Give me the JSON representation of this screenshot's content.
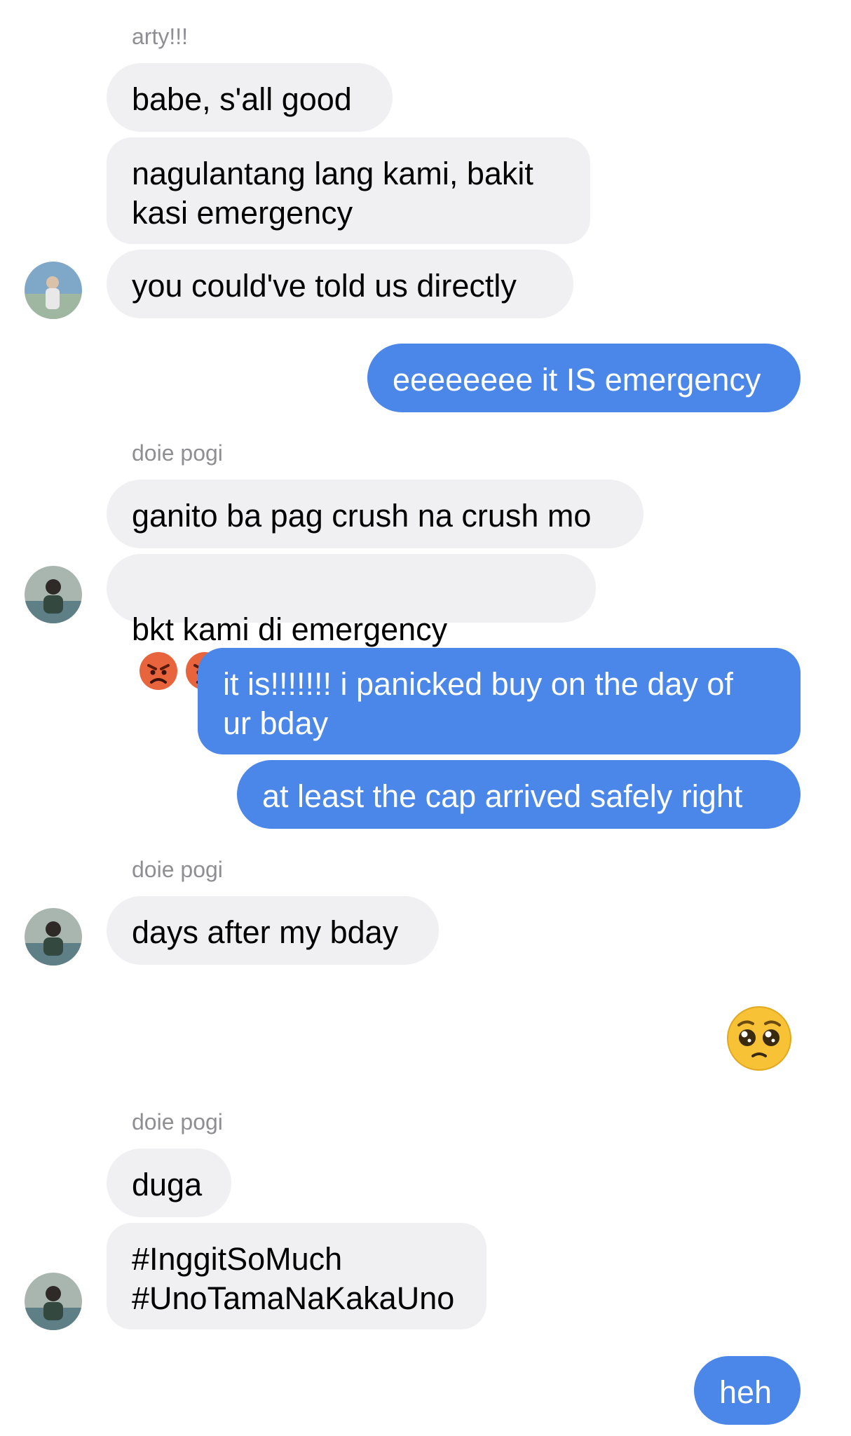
{
  "messages": [
    {
      "sender": "arty!!!"
    },
    {
      "text": "babe, s'all good"
    },
    {
      "text": "nagulantang lang kami, bakit\nkasi emergency"
    },
    {
      "text": "you could've told us directly"
    },
    {
      "text": "eeeeeeee it IS emergency"
    },
    {
      "sender": "doie pogi"
    },
    {
      "text": "ganito ba pag crush na crush mo"
    },
    {
      "text": "bkt kami di emergency",
      "emoji": "angry-face"
    },
    {
      "text": "it is!!!!!!! i panicked buy on the day of\nur bday"
    },
    {
      "text": "at least the cap arrived safely right"
    },
    {
      "sender": "doie pogi"
    },
    {
      "text": "days after my bday"
    },
    {
      "emoji": "pleading-face"
    },
    {
      "sender": "doie pogi"
    },
    {
      "text": "duga"
    },
    {
      "text": "#InggitSoMuch\n#UnoTamaNaKakaUno"
    },
    {
      "text": "heh"
    }
  ],
  "colors": {
    "incoming_bubble": "#f0f0f2",
    "outgoing_bubble": "#4b86e9",
    "sender_name": "#8e8e93"
  }
}
